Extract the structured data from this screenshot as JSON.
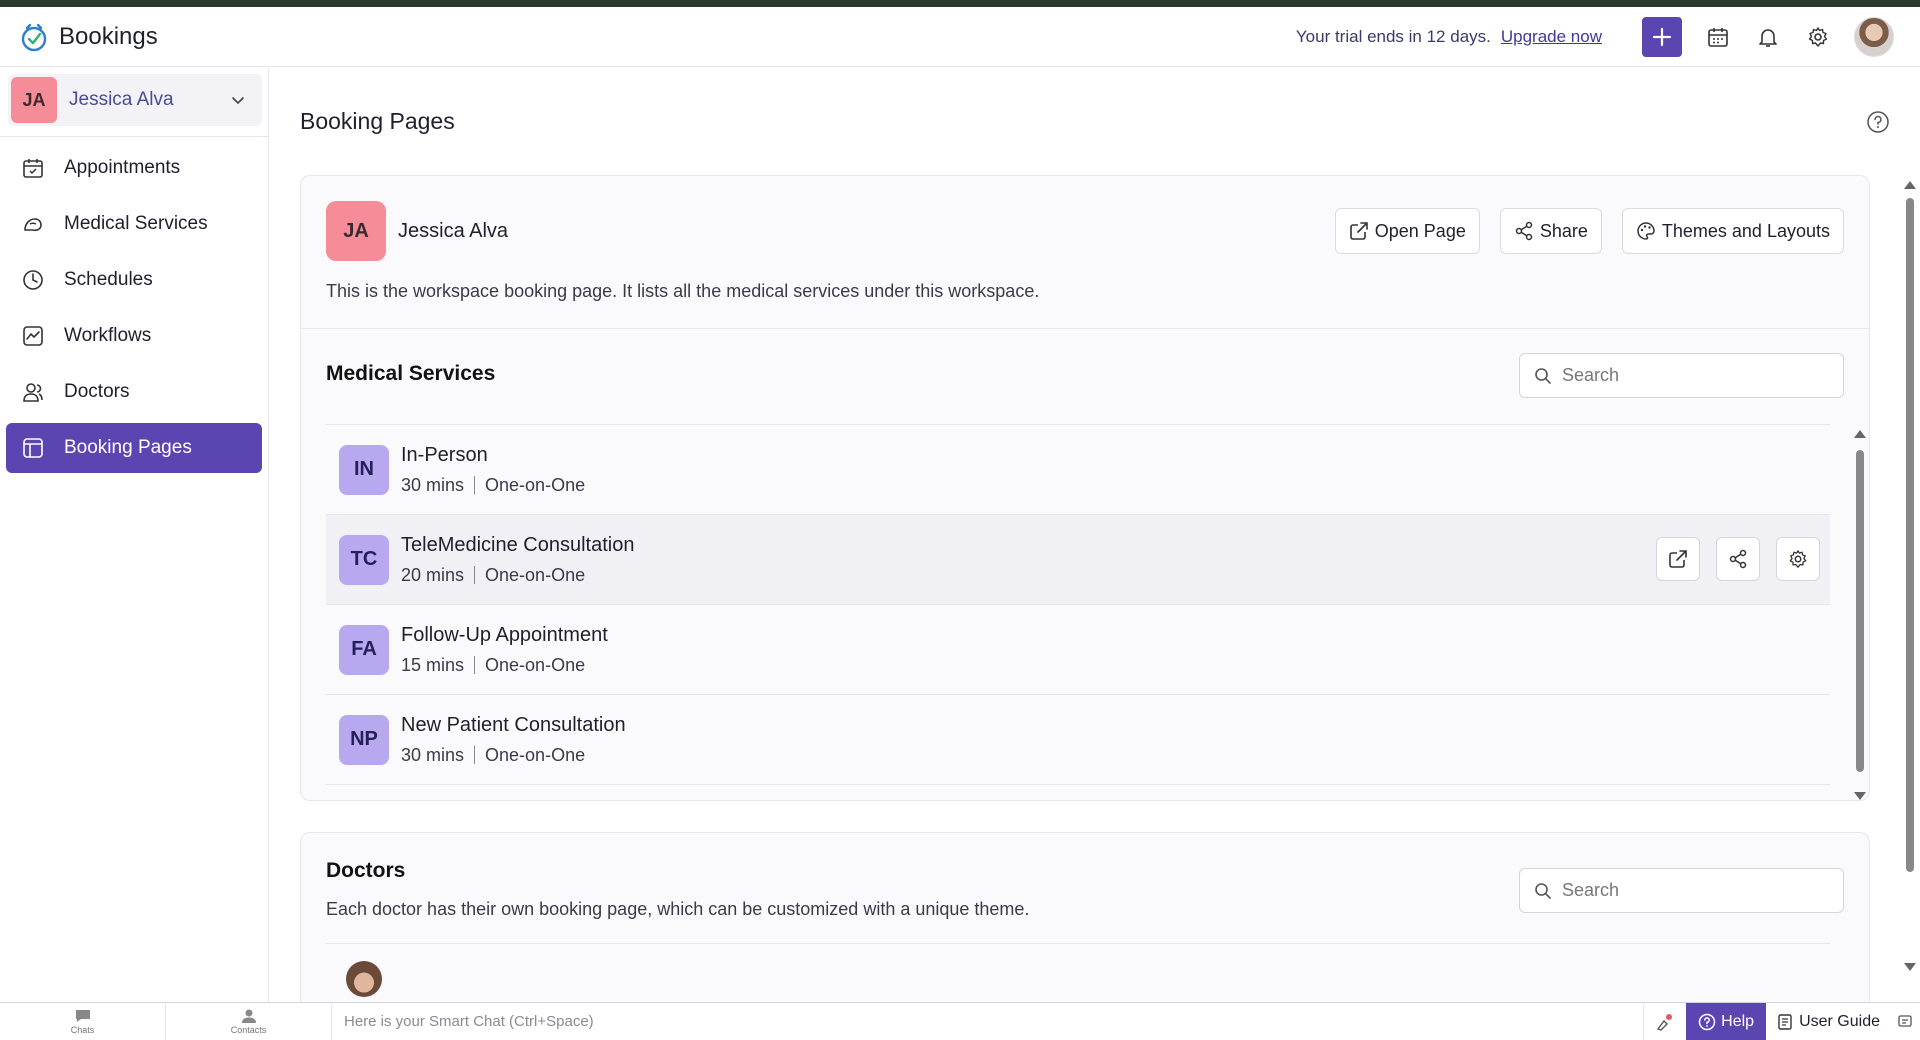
{
  "app": {
    "name": "Bookings"
  },
  "header": {
    "trial_text": "Your trial ends in 12 days.",
    "upgrade_label": "Upgrade now"
  },
  "sidebar": {
    "workspace": {
      "initials": "JA",
      "name": "Jessica Alva"
    },
    "items": [
      {
        "label": "Appointments",
        "icon": "calendar-icon",
        "active": false
      },
      {
        "label": "Medical Services",
        "icon": "services-icon",
        "active": false
      },
      {
        "label": "Schedules",
        "icon": "clock-icon",
        "active": false
      },
      {
        "label": "Workflows",
        "icon": "workflow-icon",
        "active": false
      },
      {
        "label": "Doctors",
        "icon": "people-icon",
        "active": false
      },
      {
        "label": "Booking Pages",
        "icon": "booking-page-icon",
        "active": true
      }
    ]
  },
  "main": {
    "title": "Booking Pages",
    "workspace_card": {
      "initials": "JA",
      "name": "Jessica Alva",
      "description": "This is the workspace booking page. It lists all the medical services under this workspace.",
      "open_page_label": "Open Page",
      "share_label": "Share",
      "themes_label": "Themes and Layouts"
    },
    "services": {
      "title": "Medical Services",
      "search_placeholder": "Search",
      "items": [
        {
          "initials": "IN",
          "name": "In-Person",
          "duration": "30 mins",
          "type": "One-on-One"
        },
        {
          "initials": "TC",
          "name": "TeleMedicine Consultation",
          "duration": "20 mins",
          "type": "One-on-One"
        },
        {
          "initials": "FA",
          "name": "Follow-Up Appointment",
          "duration": "15 mins",
          "type": "One-on-One"
        },
        {
          "initials": "NP",
          "name": "New Patient Consultation",
          "duration": "30 mins",
          "type": "One-on-One"
        }
      ]
    },
    "doctors": {
      "title": "Doctors",
      "description": "Each doctor has their own booking page, which can be customized with a unique theme.",
      "search_placeholder": "Search"
    }
  },
  "bottombar": {
    "chats_label": "Chats",
    "contacts_label": "Contacts",
    "smartchat_placeholder": "Here is your Smart Chat (Ctrl+Space)",
    "help_label": "Help",
    "user_guide_label": "User Guide"
  },
  "colors": {
    "accent": "#5b45b0",
    "avatar_pink": "#f58c98",
    "avatar_purple": "#b8a8f0"
  }
}
